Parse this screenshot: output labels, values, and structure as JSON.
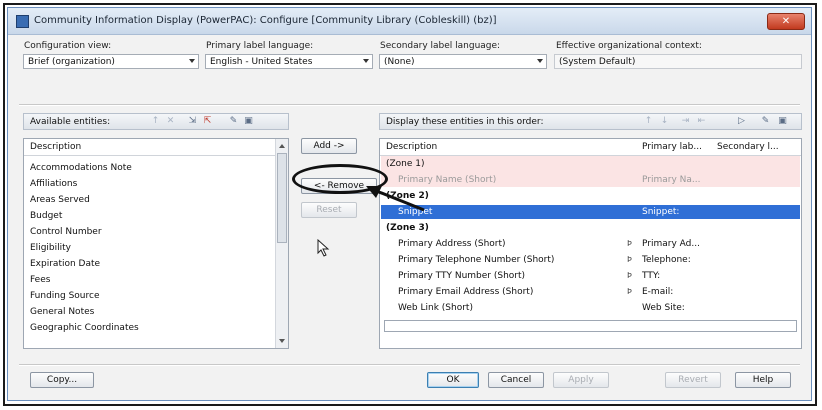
{
  "window": {
    "title": "Community Information Display (PowerPAC): Configure [Community Library (Cobleskill) (bz)]",
    "close_glyph": "✕"
  },
  "config": {
    "view_label": "Configuration view:",
    "view_value": "Brief (organization)",
    "primary_label": "Primary label language:",
    "primary_value": "English - United States",
    "secondary_label": "Secondary label language:",
    "secondary_value": "(None)",
    "context_label": "Effective organizational context:",
    "context_value": "(System Default)"
  },
  "available": {
    "header": "Available entities:",
    "column": "Description",
    "items": [
      "Accommodations Note",
      "Affiliations",
      "Areas Served",
      "Budget",
      "Control Number",
      "Eligibility",
      "Expiration Date",
      "Fees",
      "Funding Source",
      "General Notes",
      "Geographic Coordinates"
    ]
  },
  "middle_buttons": {
    "add": "Add ->",
    "remove": "<- Remove",
    "reset": "Reset"
  },
  "display": {
    "header": "Display these entities in this order:",
    "columns": [
      "Description",
      "Primary lab...",
      "Secondary l..."
    ],
    "zone1": "(Zone 1)",
    "zone1_entity": "Primary Name (Short)",
    "zone1_label": "Primary Na...",
    "zone2": "(Zone 2)",
    "zone2_entity": "Snippet",
    "zone2_label": "Snippet:",
    "zone3": "(Zone 3)",
    "zone3_rows": [
      {
        "entity": "Primary Address (Short)",
        "label": "Primary Ad...",
        "flag": true
      },
      {
        "entity": "Primary Telephone Number (Short)",
        "label": "Telephone:",
        "flag": true
      },
      {
        "entity": "Primary TTY Number (Short)",
        "label": "TTY:",
        "flag": true
      },
      {
        "entity": "Primary Email Address (Short)",
        "label": "E-mail:",
        "flag": true
      },
      {
        "entity": "Web Link (Short)",
        "label": "Web Site:",
        "flag": false
      }
    ]
  },
  "footer": {
    "copy": "Copy...",
    "ok": "OK",
    "cancel": "Cancel",
    "apply": "Apply",
    "revert": "Revert",
    "help": "Help"
  },
  "icons": {
    "tool_left": [
      "sort-up-icon",
      "delete-icon",
      "move-in-icon",
      "move-out-icon",
      "edit-icon",
      "properties-icon"
    ],
    "tool_right": [
      "move-up-icon",
      "move-down-icon",
      "merge-zone-icon",
      "split-zone-icon",
      "preview-icon",
      "edit-icon",
      "properties-icon"
    ],
    "flag_glyph": "Þ"
  },
  "colors": {
    "selection": "#2f6fd6",
    "close_button": "#c13a1f",
    "zone_highlight": "#fbe4e4"
  }
}
